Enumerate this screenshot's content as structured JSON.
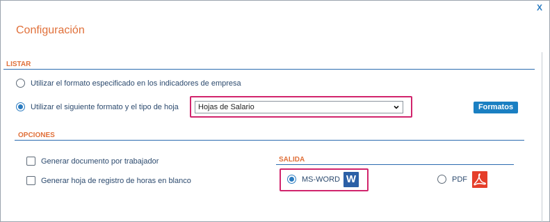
{
  "window": {
    "title": "Configuración",
    "close_label": "X"
  },
  "listar": {
    "section_label": "LISTAR",
    "option_empresa": "Utilizar el formato especificado en los indicadores de empresa",
    "option_siguiente": "Utilizar el siguiente formato y el tipo de hoja",
    "selected_option": "option_siguiente",
    "tipo_hoja_value": "Hojas de Salario",
    "formatos_button": "Formatos"
  },
  "opciones": {
    "section_label": "OPCIONES",
    "doc_por_trabajador": "Generar documento por trabajador",
    "hoja_registro": "Generar hoja de registro de horas en blanco",
    "doc_por_trabajador_checked": false,
    "hoja_registro_checked": false
  },
  "salida": {
    "section_label": "SALIDA",
    "msword_label": "MS-WORD",
    "pdf_label": "PDF",
    "selected": "MS-WORD",
    "word_icon_letter": "W"
  },
  "colors": {
    "accent_orange": "#e0703a",
    "accent_blue": "#2a7bc0",
    "highlight": "#d1246c",
    "pdf_red": "#e53e2a",
    "word_blue": "#2b5fa6"
  }
}
